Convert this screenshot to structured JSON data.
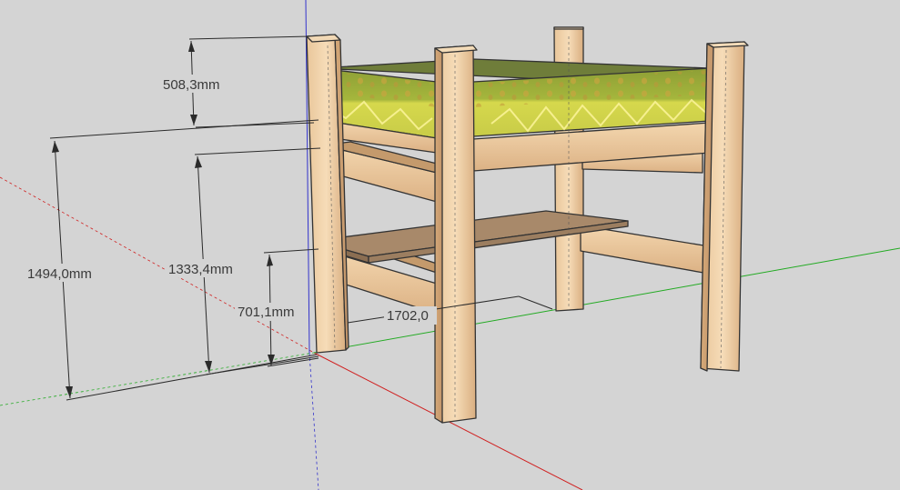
{
  "dimensions": {
    "mattress_height": "508,3mm",
    "total_height": "1494,0mm",
    "frame_height": "1333,4mm",
    "shelf_height": "701,1mm",
    "length": "1702,0"
  },
  "colors": {
    "background": "#d4d4d4",
    "axis_red": "#d02020",
    "axis_green": "#22aa22",
    "axis_blue": "#3333cc",
    "wood_light": "#f0d3aa",
    "wood_mid": "#e2b88a",
    "wood_dark": "#c49a6c",
    "mattress_top": "#6f7d3a",
    "mattress_side_top": "#96a83a",
    "mattress_side_bottom": "#cbd24a",
    "shelf": "#a8896a"
  },
  "axes": [
    "red-axis",
    "green-axis",
    "blue-axis"
  ]
}
